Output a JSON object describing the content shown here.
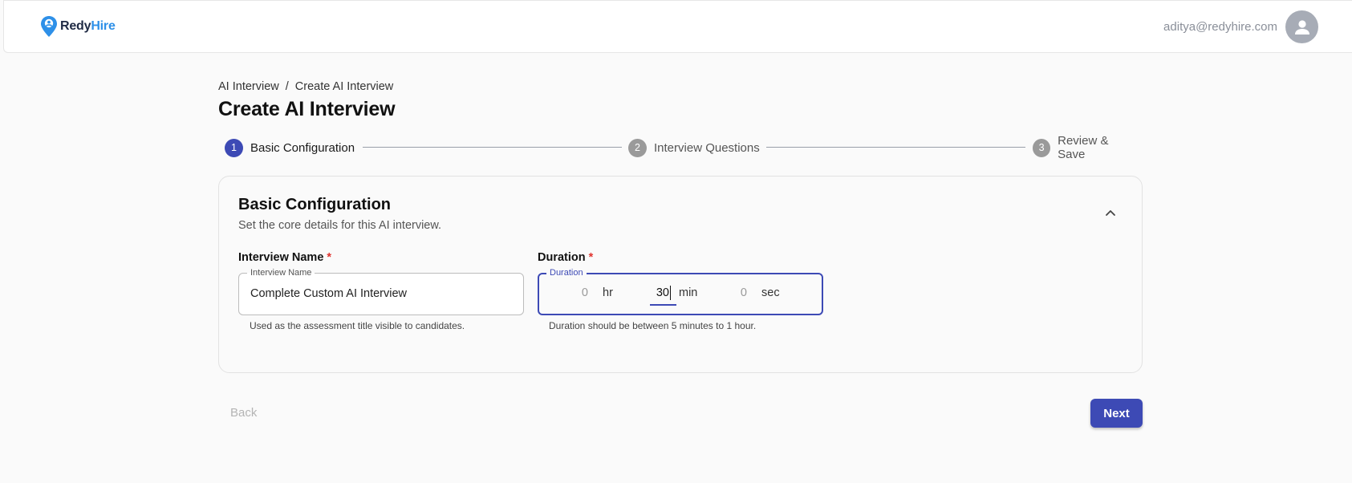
{
  "brand": {
    "name_part1": "Redy",
    "name_part2": "Hire",
    "primary_color": "#3d4ab5",
    "logo_color": "#2e90e8"
  },
  "header": {
    "user_email": "aditya@redyhire.com"
  },
  "breadcrumb": {
    "items": [
      "AI Interview",
      "Create AI Interview"
    ],
    "separator": "/"
  },
  "page_title": "Create AI Interview",
  "stepper": {
    "steps": [
      {
        "number": "1",
        "label": "Basic Configuration",
        "state": "active"
      },
      {
        "number": "2",
        "label": "Interview Questions",
        "state": "inactive"
      },
      {
        "number": "3",
        "label": "Review & Save",
        "state": "inactive"
      }
    ]
  },
  "card": {
    "title": "Basic Configuration",
    "subtitle": "Set the core details for this AI interview.",
    "interview_name": {
      "label": "Interview Name",
      "required_mark": "*",
      "legend": "Interview Name",
      "value": "Complete Custom AI Interview",
      "helper": "Used as the assessment title visible to candidates."
    },
    "duration": {
      "label": "Duration",
      "required_mark": "*",
      "legend": "Duration",
      "hours": "0",
      "hours_unit": "hr",
      "minutes": "30",
      "minutes_unit": "min",
      "seconds": "0",
      "seconds_unit": "sec",
      "helper": "Duration should be between 5 minutes to 1 hour."
    }
  },
  "footer": {
    "back_label": "Back",
    "next_label": "Next"
  }
}
